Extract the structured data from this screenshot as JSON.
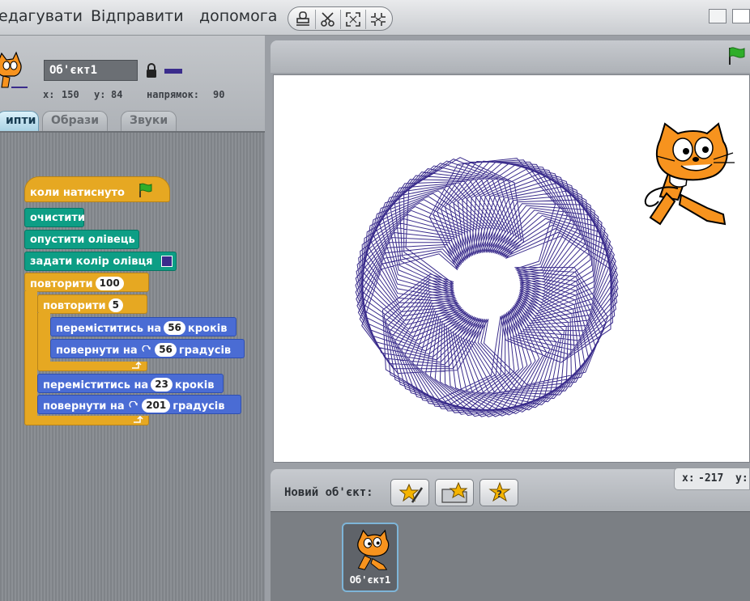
{
  "menu": {
    "items": [
      "едагувати",
      "Відправити",
      "допомога"
    ]
  },
  "toolbar": {
    "tools": [
      "stamp-icon",
      "scissors-icon",
      "grow-icon",
      "shrink-icon"
    ]
  },
  "sprite": {
    "name": "Об'єкт1",
    "x_label": "x:",
    "x_value": "150",
    "y_label": "y:",
    "y_value": "84",
    "direction_label": "напрямок:",
    "direction_value": "90",
    "pen_color": "#3a2c8c"
  },
  "tabs": [
    {
      "label": "ипти",
      "active": true
    },
    {
      "label": "Образи",
      "active": false
    },
    {
      "label": "Звуки",
      "active": false
    }
  ],
  "script": {
    "hat_label": "коли натиснуто",
    "clear_label": "очистити",
    "pen_down_label": "опустити олівець",
    "set_pen_color_label": "задати колір олівця",
    "repeat_outer_label": "повторити",
    "repeat_outer_value": "100",
    "repeat_inner_label": "повторити",
    "repeat_inner_value": "5",
    "inner_move_label": "переміститись на",
    "inner_move_value": "56",
    "inner_move_unit": "кроків",
    "inner_turn_label": "повернути на",
    "inner_turn_value": "56",
    "inner_turn_unit": "градусів",
    "outer_move_label": "переміститись на",
    "outer_move_value": "23",
    "outer_move_unit": "кроків",
    "outer_turn_label": "повернути на",
    "outer_turn_value": "201",
    "outer_turn_unit": "градусів"
  },
  "new_sprite": {
    "label": "Новий об'єкт:",
    "buttons": [
      "paint-sprite-icon",
      "choose-sprite-folder-icon",
      "random-sprite-icon"
    ]
  },
  "mouse": {
    "x_label": "x:",
    "x_value": "-217",
    "y_label": "y:"
  },
  "sprite_list": {
    "items": [
      {
        "name": "Об'єкт1"
      }
    ]
  },
  "colors": {
    "pen": "#3a2c8c",
    "control": "#e6a822",
    "pen_blocks": "#0d9e85",
    "motion": "#4a6cd4",
    "cat_orange": "#f7931e"
  }
}
